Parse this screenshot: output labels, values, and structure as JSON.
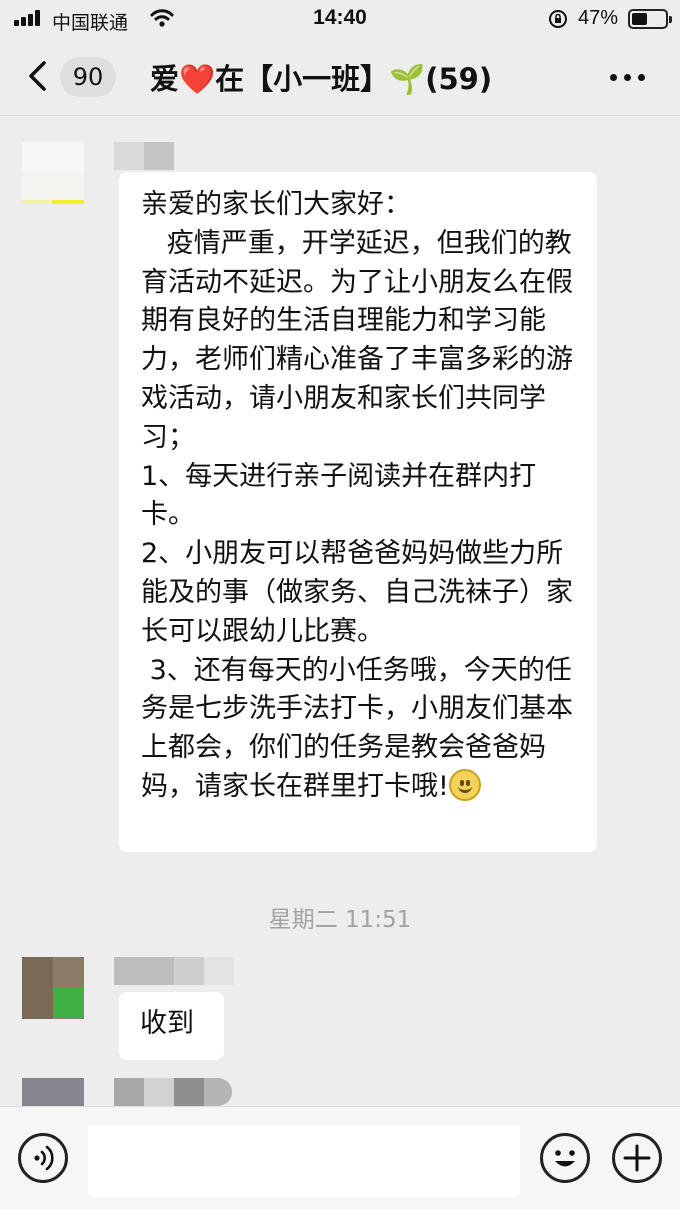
{
  "status_bar": {
    "carrier": "中国联通",
    "time": "14:40",
    "battery_percent": "47%",
    "battery_level": 0.47
  },
  "header": {
    "back_count": "90",
    "title": "爱❤️在【小一班】🌱(59)"
  },
  "messages": [
    {
      "sender": "blurred",
      "text": "亲爱的家长们大家好：\n   疫情严重，开学延迟，但我们的教育活动不延迟。为了让小朋友么在假期有良好的生活自理能力和学习能力，老师们精心准备了丰富多彩的游戏活动，请小朋友和家长们共同学习；\n1、每天进行亲子阅读并在群内打卡。\n2、小朋友可以帮爸爸妈妈做些力所能及的事（做家务、自己洗袜子）家长可以跟幼儿比赛。\n 3、还有每天的小任务哦，今天的任务是七步洗手法打卡，小朋友们基本上都会，你们的任务是教会爸爸妈妈，请家长在群里打卡哦!",
      "emoji": "smile-emoji"
    },
    {
      "sender": "blurred",
      "text": "收到"
    }
  ],
  "time_separator": "星期二 11:51",
  "icons": {
    "back": "chevron-left-icon",
    "more": "more-dots-icon",
    "voice": "voice-icon",
    "emoji": "emoji-icon",
    "plus": "plus-icon"
  }
}
